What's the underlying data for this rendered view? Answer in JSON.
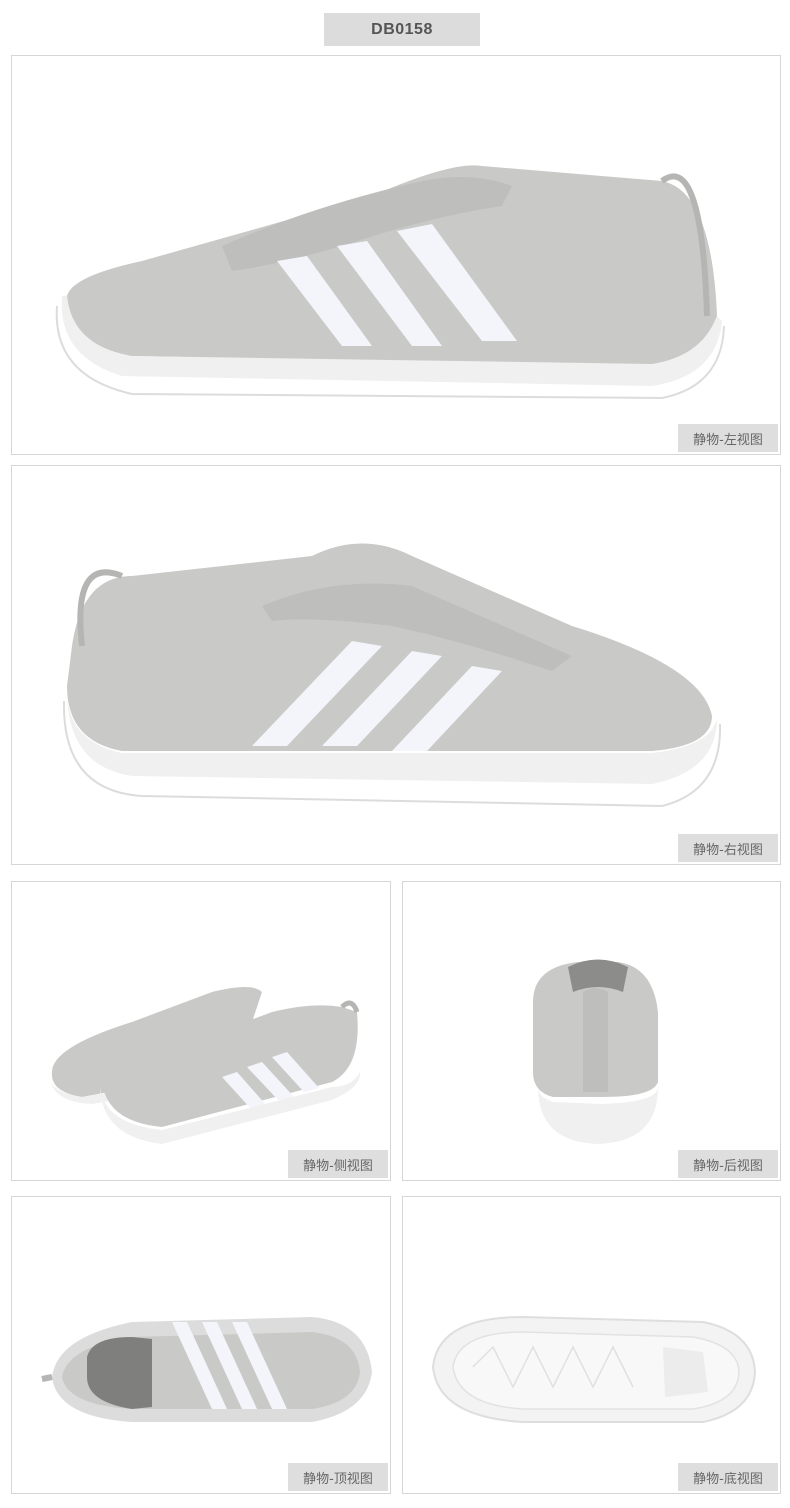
{
  "product_code": "DB0158",
  "views": {
    "left": "静物-左视图",
    "right": "静物-右视图",
    "side": "静物-侧视图",
    "back": "静物-后视图",
    "top": "静物-顶视图",
    "bottom": "静物-底视图"
  },
  "colors": {
    "upper": "#c9c9c7",
    "stripe": "#f4f5fb",
    "sole": "#f0f0f0",
    "border": "#d6d6d6",
    "label_bg": "#dedede"
  }
}
